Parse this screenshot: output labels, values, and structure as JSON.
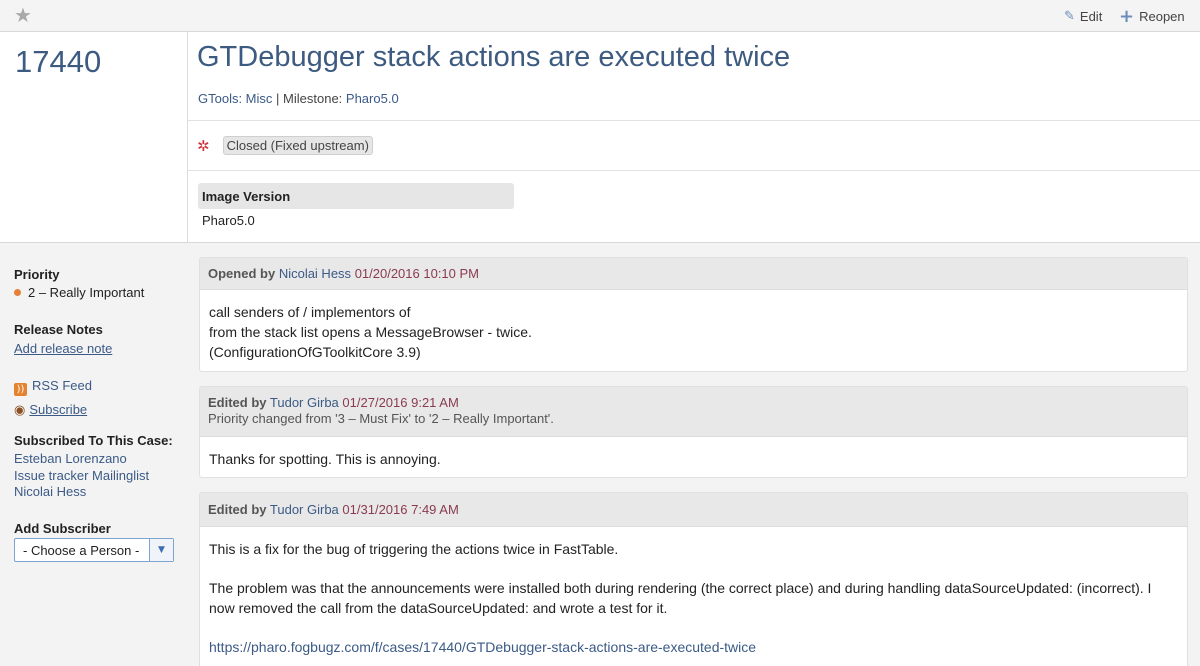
{
  "toolbar": {
    "edit_label": "Edit",
    "reopen_label": "Reopen"
  },
  "case": {
    "number": "17440",
    "title": "GTDebugger stack actions are executed twice",
    "project": "GTools: Misc",
    "milestone_label": "Milestone:",
    "milestone": "Pharo5.0",
    "status": "Closed (Fixed upstream)",
    "field_label": "Image Version",
    "field_value": "Pharo5.0"
  },
  "sidebar": {
    "priority_label": "Priority",
    "priority_value": "2 – Really Important",
    "release_notes_label": "Release Notes",
    "add_release_note": "Add release note",
    "rss_feed": "RSS Feed",
    "subscribe": "Subscribe",
    "subscribed_label": "Subscribed To This Case:",
    "subscribers": [
      "Esteban Lorenzano",
      "Issue tracker Mailinglist",
      "Nicolai Hess"
    ],
    "add_subscriber_label": "Add Subscriber",
    "select_value": "- Choose a Person -"
  },
  "events": [
    {
      "verb": "Opened by",
      "user": "Nicolai Hess",
      "date": "01/20/2016 10:10 PM",
      "lines": [
        "call senders of / implementors of",
        "from the stack list opens a MessageBrowser - twice.",
        "(ConfigurationOfGToolkitCore 3.9)"
      ]
    },
    {
      "verb": "Edited by",
      "user": "Tudor Girba",
      "date": "01/27/2016 9:21 AM",
      "change": "Priority changed from '3 – Must Fix' to '2 – Really Important'.",
      "lines": [
        "Thanks for spotting. This is annoying."
      ]
    },
    {
      "verb": "Edited by",
      "user": "Tudor Girba",
      "date": "01/31/2016 7:49 AM",
      "lines": [
        "This is a fix for the bug of triggering the actions twice in FastTable.",
        "The problem was that the announcements were installed both during rendering (the correct place) and during handling dataSourceUpdated: (incorrect). I now removed the call from the dataSourceUpdated: and wrote a test for it."
      ],
      "link": "https://pharo.fogbugz.com/f/cases/17440/GTDebugger-stack-actions-are-executed-twice"
    }
  ]
}
